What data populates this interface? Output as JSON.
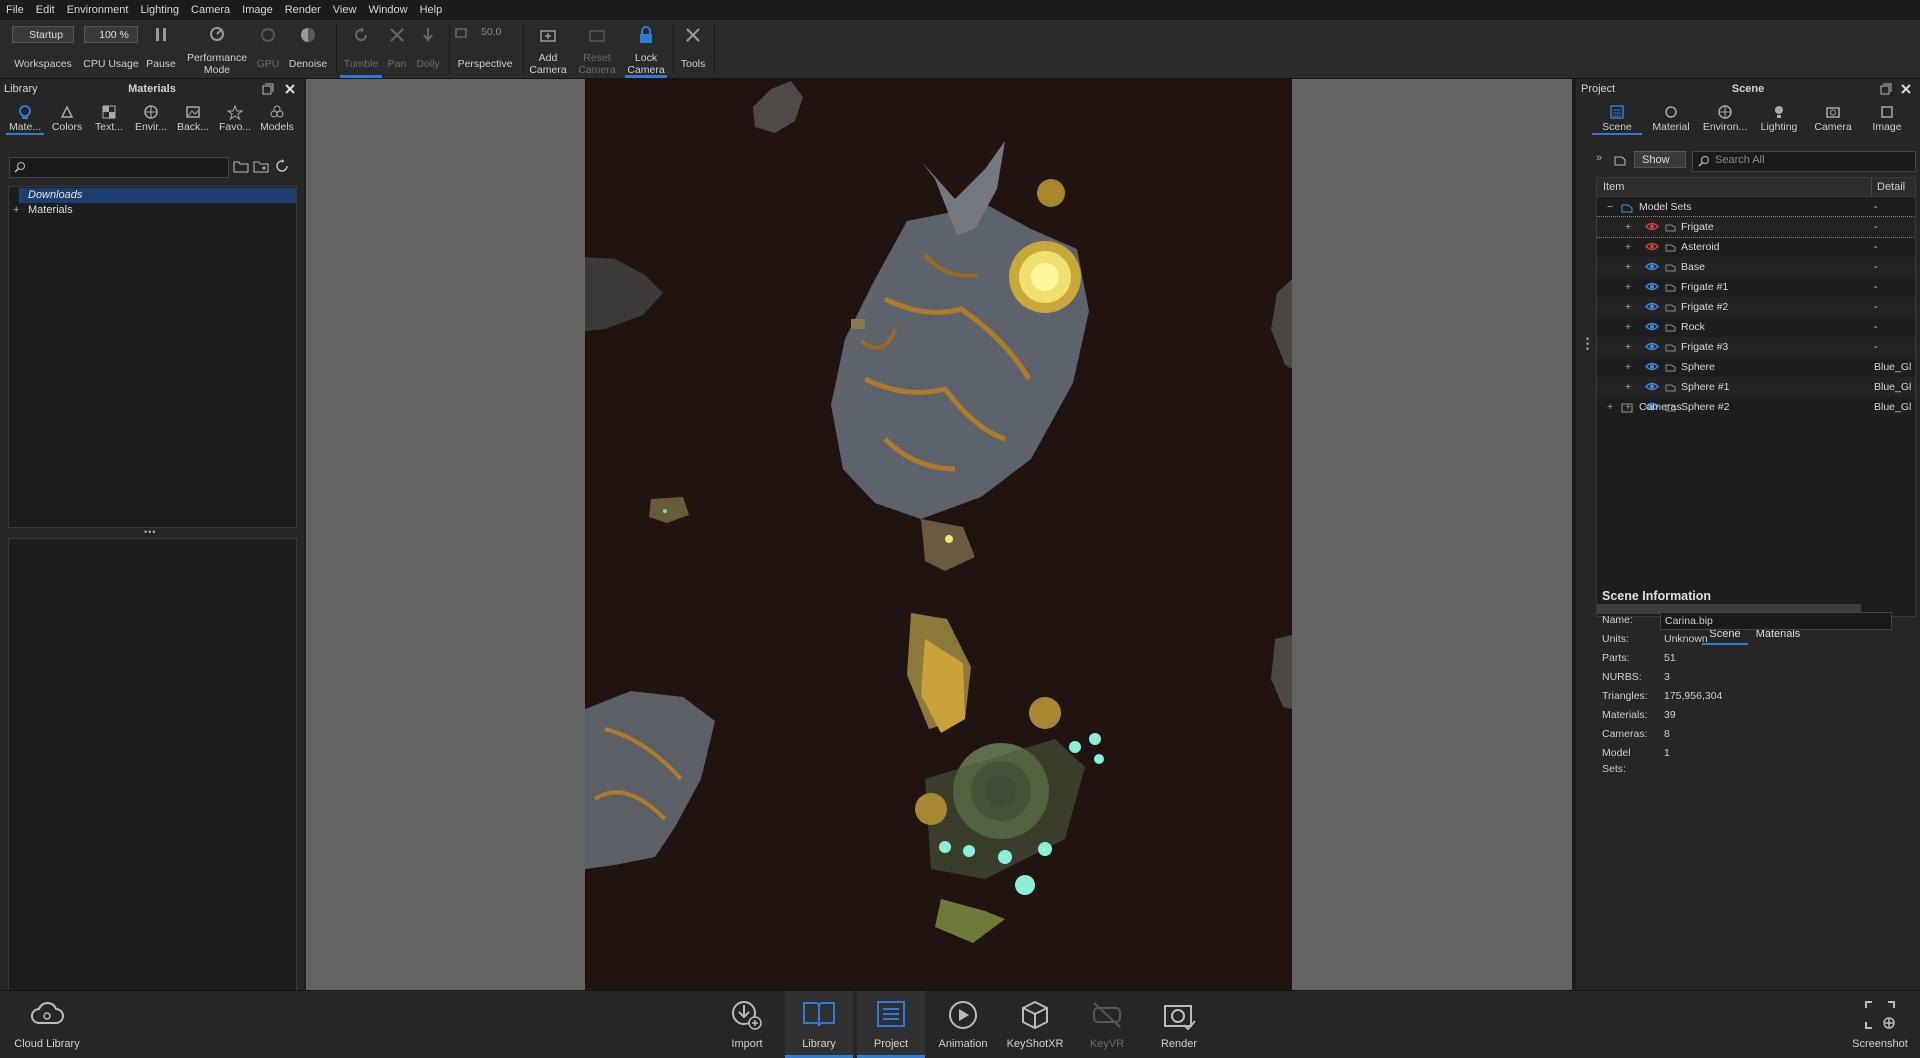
{
  "menu": [
    "File",
    "Edit",
    "Environment",
    "Lighting",
    "Camera",
    "Image",
    "Render",
    "View",
    "Window",
    "Help"
  ],
  "toolbar": {
    "workspace_value": "Startup",
    "workspaces_label": "Workspaces",
    "cpu_value": "100 %",
    "cpu_label": "CPU Usage",
    "pause_label": "Pause",
    "performance_label_1": "Performance",
    "performance_label_2": "Mode",
    "gpu_label": "GPU",
    "denoise_label": "Denoise",
    "tumble_label": "Tumble",
    "pan_label": "Pan",
    "dolly_label": "Dolly",
    "fov_value": "50.0",
    "perspective_label": "Perspective",
    "add_camera_1": "Add",
    "add_camera_2": "Camera",
    "reset_camera_1": "Reset",
    "reset_camera_2": "Camera",
    "lock_camera_1": "Lock",
    "lock_camera_2": "Camera",
    "tools_label": "Tools"
  },
  "library": {
    "panel_label": "Library",
    "title": "Materials",
    "tabs": [
      "Mate...",
      "Colors",
      "Text...",
      "Envir...",
      "Back...",
      "Favo...",
      "Models"
    ],
    "tree": [
      "Downloads",
      "Materials"
    ]
  },
  "project": {
    "panel_label": "Project",
    "title": "Scene",
    "tabs": [
      "Scene",
      "Material",
      "Environ...",
      "Lighting",
      "Camera",
      "Image"
    ],
    "show_label": "Show",
    "search_placeholder": "Search All",
    "col_item": "Item",
    "col_detail": "Detail",
    "model_sets": "Model Sets",
    "model_sets_detail": "-",
    "items": [
      {
        "name": "Frigate",
        "detail": "-",
        "visible": false
      },
      {
        "name": "Asteroid",
        "detail": "-",
        "visible": false
      },
      {
        "name": "Base",
        "detail": "-",
        "visible": true
      },
      {
        "name": "Frigate #1",
        "detail": "-",
        "visible": true
      },
      {
        "name": "Frigate #2",
        "detail": "-",
        "visible": true
      },
      {
        "name": "Rock",
        "detail": "-",
        "visible": true
      },
      {
        "name": "Frigate #3",
        "detail": "-",
        "visible": true
      },
      {
        "name": "Sphere",
        "detail": "Blue_Gl",
        "visible": true
      },
      {
        "name": "Sphere #1",
        "detail": "Blue_Gl",
        "visible": true
      },
      {
        "name": "Sphere #2",
        "detail": "Blue_Gl",
        "visible": true
      }
    ],
    "cameras": "Cameras",
    "subtabs": [
      "Scene",
      "Materials"
    ],
    "info_title": "Scene Information",
    "info": {
      "name_label": "Name:",
      "name_value": "Carina.bip",
      "units_label": "Units:",
      "units_value": "Unknown",
      "parts_label": "Parts:",
      "parts_value": "51",
      "nurbs_label": "NURBS:",
      "nurbs_value": "3",
      "triangles_label": "Triangles:",
      "triangles_value": "175,956,304",
      "materials_label": "Materials:",
      "materials_value": "39",
      "cameras_label": "Cameras:",
      "cameras_value": "8",
      "modelsets_label": "Model Sets:",
      "modelsets_value": "1"
    }
  },
  "bottom": {
    "cloud_library": "Cloud Library",
    "import": "Import",
    "library": "Library",
    "project": "Project",
    "animation": "Animation",
    "keyshotxr": "KeyShotXR",
    "keyvr": "KeyVR",
    "render": "Render",
    "screenshot": "Screenshot"
  },
  "colors": {
    "accent": "#2f7bd8",
    "viewport_bg": "#21130f",
    "eye_on": "#3d8ee8",
    "eye_off": "#d04040"
  }
}
